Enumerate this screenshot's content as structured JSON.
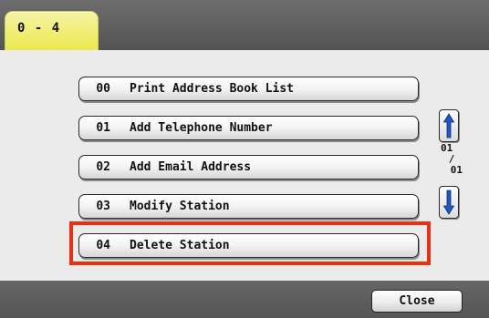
{
  "tab": {
    "label": "0 - 4"
  },
  "menu": {
    "items": [
      {
        "number": "00",
        "label": "Print Address Book List"
      },
      {
        "number": "01",
        "label": "Add Telephone Number"
      },
      {
        "number": "02",
        "label": "Add Email Address"
      },
      {
        "number": "03",
        "label": "Modify Station"
      },
      {
        "number": "04",
        "label": "Delete Station"
      }
    ]
  },
  "pager": {
    "current": "01",
    "separator": "/",
    "total": "01"
  },
  "footer": {
    "close_label": "Close"
  },
  "colors": {
    "highlight": "#ee2e10",
    "tab": "#f1ef7c",
    "bar": "#5f5f5f"
  }
}
